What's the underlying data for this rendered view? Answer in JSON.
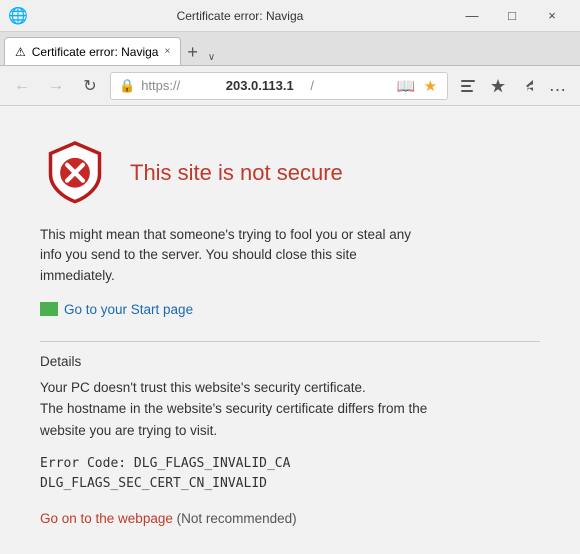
{
  "titlebar": {
    "title": "Certificate error: Naviga"
  },
  "tab": {
    "label": "Certificate error: Naviga",
    "close": "×"
  },
  "address": {
    "url": "https://",
    "domain": "203.0.113.1",
    "path": " /",
    "full": "https:// 203.0.113.1 /"
  },
  "nav": {
    "back": "←",
    "forward": "→",
    "refresh": "↻",
    "tab_new": "+",
    "tab_dropdown": "∨"
  },
  "toolbar": {
    "read_view": "☰",
    "favorites": "☆",
    "hub": "☆",
    "share": "↗",
    "more": "…"
  },
  "content": {
    "title": "This site is not secure",
    "description": "This might mean that someone's trying to fool you or steal any info you send to the server. You should close this site immediately.",
    "start_page_label": "Go to your Start page",
    "details_heading": "Details",
    "details_text_1": "Your PC doesn't trust this website's security certificate.",
    "details_text_2": "The hostname in the website's security certificate differs from the website you are trying to visit.",
    "error_code_line1": "Error Code:  DLG_FLAGS_INVALID_CA",
    "error_code_line2": "DLG_FLAGS_SEC_CERT_CN_INVALID",
    "go_on_link": "Go on to the webpage",
    "not_recommended": "(Not recommended)"
  },
  "window": {
    "minimize": "—",
    "maximize": "□",
    "close": "×"
  }
}
